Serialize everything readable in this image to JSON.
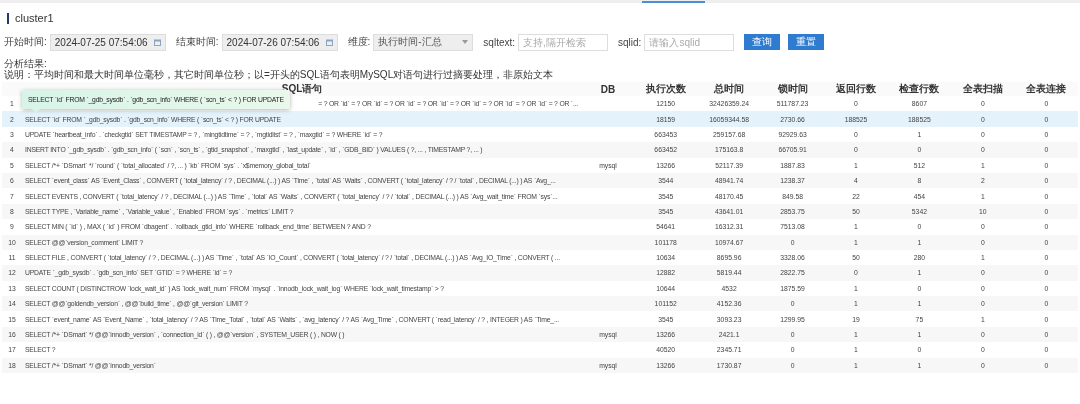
{
  "title": "cluster1",
  "filters": [
    {
      "kind": "date",
      "label": "开始时间:",
      "value": "2024-07-25 07:54:06"
    },
    {
      "kind": "date",
      "label": "结束时间:",
      "value": "2024-07-26 07:54:06"
    },
    {
      "kind": "select",
      "label": "维度:",
      "value": "执行时间-汇总"
    },
    {
      "kind": "text",
      "label": "sqltext:",
      "placeholder": "支持,隔开检索"
    },
    {
      "kind": "text",
      "label": "sqlid:",
      "placeholder": "请输入sqlid"
    }
  ],
  "buttons": [
    "查询",
    "重置"
  ],
  "notes": [
    "分析结果:",
    "说明：平均时间和最大时间单位毫秒，其它时间单位秒；以=开头的SQL语句表明MySQL对语句进行过摘要处理，非原始文本"
  ],
  "table": {
    "columns": [
      "SQL语句",
      "DB",
      "执行次数",
      "总时间",
      "锁时间",
      "返回行数",
      "检查行数",
      "全表扫描",
      "全表连接"
    ],
    "rows": [
      {
        "index": "1",
        "tooltip": "SELECT `id` FROM `_gdb_sysdb` . `gdb_scn_info` WHERE ( `scn_ts` < ? ) FOR UPDATE",
        "sql": "= ? OR `id` = ? OR `id` = ? OR `id` = ? OR `id` = ? OR `id` = ? OR `id` = ? OR `id` = ? OR `...",
        "values": [
          "12150",
          "32426359.24",
          "511787.23",
          "0",
          "8607",
          "0",
          "0"
        ],
        "selected": false
      },
      {
        "index": "2",
        "sql": "SELECT `id` FROM `_gdb_sysdb` . `gdb_scn_info` WHERE ( `scn_ts` < ? ) FOR UPDATE",
        "values": [
          "18159",
          "16059344.58",
          "2730.66",
          "188525",
          "188525",
          "0",
          "0"
        ],
        "selected": true
      },
      {
        "index": "3",
        "sql": "UPDATE `heartbeat_info` . `checkgtid` SET TIMESTAMP = ? , `mingtidtime` = ? , `mgtidlist` = ? , `maxgtid` = ? WHERE `id` = ?",
        "values": [
          "663453",
          "259157.68",
          "92929.63",
          "0",
          "1",
          "0",
          "0"
        ],
        "selected": false
      },
      {
        "index": "4",
        "sql": "INSERT INTO `_gdb_sysdb` . `gdb_scn_info` ( `scn` , `scn_ts` , `gtid_snapshot` , `maxgtid` , `last_update` , `id` , `GDB_BID` ) VALUES ( ?, ... , TIMESTAMP ?, ... )",
        "values": [
          "663452",
          "175163.8",
          "66705.91",
          "0",
          "0",
          "0",
          "0"
        ],
        "selected": false
      },
      {
        "index": "5",
        "sql": "SELECT /*+ `DSmart` */ `round` ( `total_allocated` / ?, ... ) `kb` FROM `sys` . `x$memory_global_total`",
        "db": "mysql",
        "values": [
          "13266",
          "52117.39",
          "1887.83",
          "1",
          "512",
          "1",
          "0"
        ],
        "selected": false
      },
      {
        "index": "6",
        "sql": "SELECT `event_class` AS `Event_Class` , CONVERT ( `total_latency` / ? , DECIMAL (...) ) AS `Time` , `total` AS `Waits` , CONVERT ( `total_latency` / ? / `total` , DECIMAL (...) ) AS `Avg_...",
        "values": [
          "3544",
          "48941.74",
          "1238.37",
          "4",
          "8",
          "2",
          "0"
        ],
        "selected": false
      },
      {
        "index": "7",
        "sql": "SELECT EVENTS , CONVERT ( `total_latency` / ? , DECIMAL (...) ) AS `Time` , `total` AS `Waits` , CONVERT ( `total_latency` / ? / `total` , DECIMAL (...) ) AS `Avg_wait_time` FROM `sys`...",
        "values": [
          "3545",
          "48170.45",
          "849.58",
          "22",
          "454",
          "1",
          "0"
        ],
        "selected": false
      },
      {
        "index": "8",
        "sql": "SELECT TYPE , `Variable_name` , `Variable_value` , `Enabled` FROM `sys` . `metrics` LIMIT ?",
        "values": [
          "3545",
          "43641.01",
          "2853.75",
          "50",
          "5342",
          "10",
          "0"
        ],
        "selected": false
      },
      {
        "index": "9",
        "sql": "SELECT MIN ( `id` ) , MAX ( `id` ) FROM `dbagent` . `rollback_gtid_info` WHERE `rollback_end_time` BETWEEN ? AND ?",
        "values": [
          "54641",
          "16312.31",
          "7513.08",
          "1",
          "0",
          "0",
          "0"
        ],
        "selected": false
      },
      {
        "index": "10",
        "sql": "SELECT @@`version_comment` LIMIT ?",
        "values": [
          "101178",
          "10974.67",
          "0",
          "1",
          "1",
          "0",
          "0"
        ],
        "selected": false
      },
      {
        "index": "11",
        "sql": "SELECT FILE , CONVERT ( `total_latency` / ? , DECIMAL (...) ) AS `Time` , `total` AS `IO_Count` , CONVERT ( `total_latency` / ? / `total` , DECIMAL (...) ) AS `Avg_IO_Time` , CONVERT ( ...",
        "values": [
          "10634",
          "8695.96",
          "3328.06",
          "50",
          "280",
          "1",
          "0"
        ],
        "selected": false
      },
      {
        "index": "12",
        "sql": "UPDATE `_gdb_sysdb` . `gdb_scn_info` SET `GTID` = ? WHERE `id` = ?",
        "values": [
          "12882",
          "5819.44",
          "2822.75",
          "0",
          "1",
          "0",
          "0"
        ],
        "selected": false
      },
      {
        "index": "13",
        "sql": "SELECT COUNT ( DISTINCTROW `lock_wait_id` ) AS `lock_wait_num` FROM `mysql` . `innodb_lock_wait_log` WHERE `lock_wait_timestamp` > ?",
        "values": [
          "10644",
          "4532",
          "1875.59",
          "1",
          "0",
          "0",
          "0"
        ],
        "selected": false
      },
      {
        "index": "14",
        "sql": "SELECT @@`goldendb_version` , @@`build_time` , @@`git_version` LIMIT ?",
        "values": [
          "101152",
          "4152.36",
          "0",
          "1",
          "1",
          "0",
          "0"
        ],
        "selected": false
      },
      {
        "index": "15",
        "sql": "SELECT `event_name` AS `Event_Name` , `total_latency` / ? AS `Time_Total` , `total` AS `Waits` , `avg_latency` / ? AS `Avg_Time` , CONVERT ( `read_latency` / ? , INTEGER ) AS `Time_...",
        "values": [
          "3545",
          "3093.23",
          "1299.95",
          "19",
          "75",
          "1",
          "0"
        ],
        "selected": false
      },
      {
        "index": "16",
        "sql": "SELECT /*+ `DSmart` */ @@`innodb_version` , `connection_id` ( ) , @@`version` , SYSTEM_USER ( ) , NOW ( )",
        "db": "mysql",
        "values": [
          "13266",
          "2421.1",
          "0",
          "1",
          "1",
          "0",
          "0"
        ],
        "selected": false
      },
      {
        "index": "17",
        "sql": "SELECT ?",
        "values": [
          "40520",
          "2345.71",
          "0",
          "1",
          "0",
          "0",
          "0"
        ],
        "selected": false
      },
      {
        "index": "18",
        "sql": "SELECT /*+ `DSmart` */ @@`innodb_version`",
        "db": "mysql",
        "values": [
          "13266",
          "1730.87",
          "0",
          "1",
          "1",
          "0",
          "0"
        ],
        "selected": false
      }
    ]
  }
}
